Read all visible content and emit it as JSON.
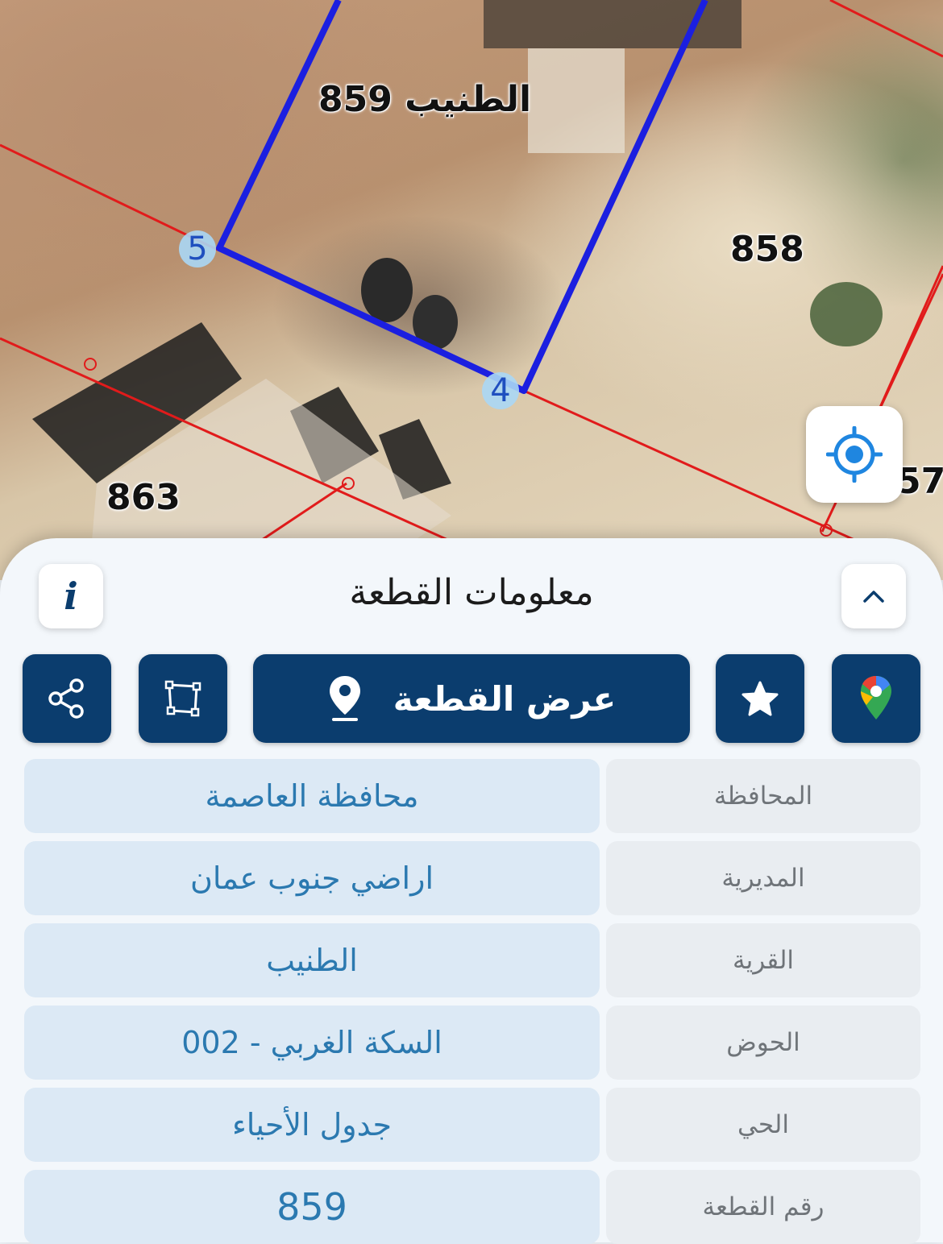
{
  "map": {
    "parcel_labels": [
      {
        "id": "main",
        "text": "الطنيب 859"
      },
      {
        "id": "east",
        "text": "858"
      },
      {
        "id": "southwest",
        "text": "863"
      },
      {
        "id": "edge",
        "text": "57"
      }
    ],
    "vertices": [
      "5",
      "4"
    ],
    "locate_icon": "crosshair-icon",
    "boundary_color": "#1b1fe0",
    "parcel_line_color": "#e11b1b"
  },
  "sheet": {
    "title": "معلومات القطعة",
    "info_icon": "i",
    "collapse_icon": "chevron-up-icon"
  },
  "actions": {
    "view_parcel_label": "عرض القطعة",
    "share_icon": "share-icon",
    "measure_icon": "polygon-icon",
    "favorite_icon": "star-icon",
    "maps_icon": "google-maps-pin-icon",
    "button_color": "#0b3d6e"
  },
  "info": [
    {
      "label": "المحافظة",
      "value": "محافظة العاصمة"
    },
    {
      "label": "المديرية",
      "value": "اراضي جنوب عمان"
    },
    {
      "label": "القرية",
      "value": "الطنيب"
    },
    {
      "label": "الحوض",
      "value": "السكة الغربي - 002"
    },
    {
      "label": "الحي",
      "value": "جدول الأحياء"
    },
    {
      "label": "رقم القطعة",
      "value": "859"
    }
  ]
}
